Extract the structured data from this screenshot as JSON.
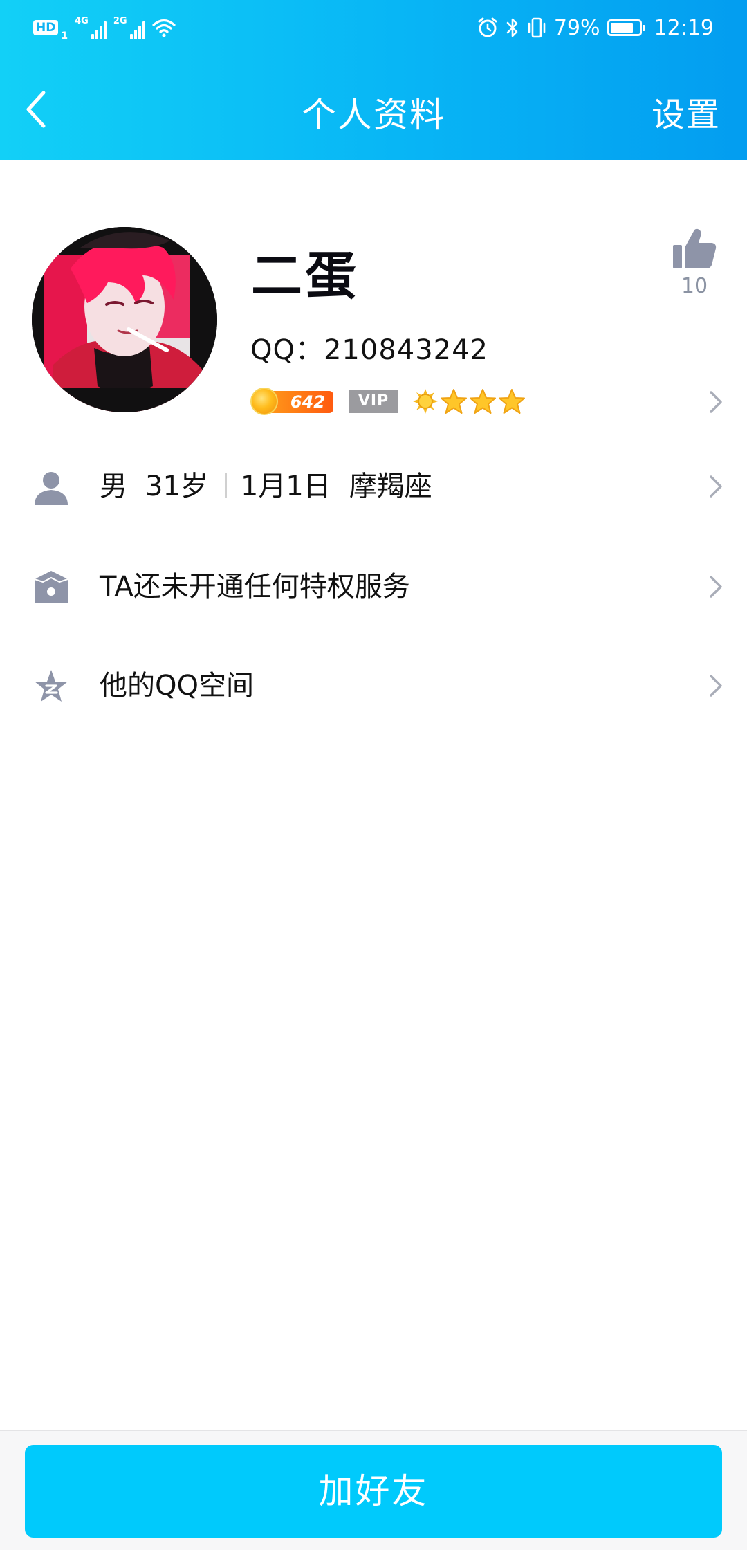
{
  "status_bar": {
    "hd_label": "HD",
    "hd_sub": "1",
    "network_1": "4G",
    "network_2": "2G",
    "battery_percent_text": "79%",
    "battery_level": 0.79,
    "time": "12:19",
    "icons": [
      "wifi-icon",
      "alarm-icon",
      "bluetooth-icon",
      "vibrate-icon",
      "battery-icon"
    ]
  },
  "header": {
    "title": "个人资料",
    "settings_label": "设置",
    "back_icon": "chevron-left-icon"
  },
  "profile": {
    "name": "二蛋",
    "qq_line": "QQ：210843242",
    "level_value": "642",
    "vip_label": "VIP",
    "level_icons": [
      "sun-icon",
      "star-icon",
      "star-icon",
      "star-icon"
    ],
    "like_count": "10",
    "like_icon": "thumbs-up-icon"
  },
  "rows": [
    {
      "icon": "person-icon",
      "gender": "男",
      "age": "31岁",
      "birthday": "1月1日",
      "zodiac": "摩羯座"
    },
    {
      "icon": "crown-icon",
      "label": "TA还未开通任何特权服务"
    },
    {
      "icon": "qzone-star-icon",
      "label": "他的QQ空间"
    }
  ],
  "footer": {
    "add_friend_label": "加好友"
  },
  "colors": {
    "header_gradient_start": "#12d0f7",
    "header_gradient_end": "#039df0",
    "button_bg": "#00cafc",
    "icon_gray": "#8e94a8",
    "level_orange": "#ff6a12",
    "vip_gray": "#9b9b9f"
  }
}
